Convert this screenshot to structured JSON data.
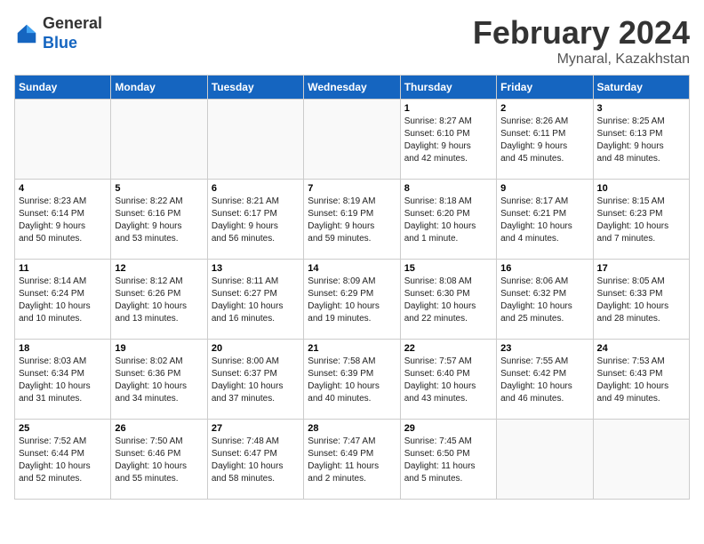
{
  "header": {
    "logo_general": "General",
    "logo_blue": "Blue",
    "title": "February 2024",
    "subtitle": "Mynaral, Kazakhstan"
  },
  "weekdays": [
    "Sunday",
    "Monday",
    "Tuesday",
    "Wednesday",
    "Thursday",
    "Friday",
    "Saturday"
  ],
  "weeks": [
    [
      {
        "day": "",
        "info": ""
      },
      {
        "day": "",
        "info": ""
      },
      {
        "day": "",
        "info": ""
      },
      {
        "day": "",
        "info": ""
      },
      {
        "day": "1",
        "info": "Sunrise: 8:27 AM\nSunset: 6:10 PM\nDaylight: 9 hours\nand 42 minutes."
      },
      {
        "day": "2",
        "info": "Sunrise: 8:26 AM\nSunset: 6:11 PM\nDaylight: 9 hours\nand 45 minutes."
      },
      {
        "day": "3",
        "info": "Sunrise: 8:25 AM\nSunset: 6:13 PM\nDaylight: 9 hours\nand 48 minutes."
      }
    ],
    [
      {
        "day": "4",
        "info": "Sunrise: 8:23 AM\nSunset: 6:14 PM\nDaylight: 9 hours\nand 50 minutes."
      },
      {
        "day": "5",
        "info": "Sunrise: 8:22 AM\nSunset: 6:16 PM\nDaylight: 9 hours\nand 53 minutes."
      },
      {
        "day": "6",
        "info": "Sunrise: 8:21 AM\nSunset: 6:17 PM\nDaylight: 9 hours\nand 56 minutes."
      },
      {
        "day": "7",
        "info": "Sunrise: 8:19 AM\nSunset: 6:19 PM\nDaylight: 9 hours\nand 59 minutes."
      },
      {
        "day": "8",
        "info": "Sunrise: 8:18 AM\nSunset: 6:20 PM\nDaylight: 10 hours\nand 1 minute."
      },
      {
        "day": "9",
        "info": "Sunrise: 8:17 AM\nSunset: 6:21 PM\nDaylight: 10 hours\nand 4 minutes."
      },
      {
        "day": "10",
        "info": "Sunrise: 8:15 AM\nSunset: 6:23 PM\nDaylight: 10 hours\nand 7 minutes."
      }
    ],
    [
      {
        "day": "11",
        "info": "Sunrise: 8:14 AM\nSunset: 6:24 PM\nDaylight: 10 hours\nand 10 minutes."
      },
      {
        "day": "12",
        "info": "Sunrise: 8:12 AM\nSunset: 6:26 PM\nDaylight: 10 hours\nand 13 minutes."
      },
      {
        "day": "13",
        "info": "Sunrise: 8:11 AM\nSunset: 6:27 PM\nDaylight: 10 hours\nand 16 minutes."
      },
      {
        "day": "14",
        "info": "Sunrise: 8:09 AM\nSunset: 6:29 PM\nDaylight: 10 hours\nand 19 minutes."
      },
      {
        "day": "15",
        "info": "Sunrise: 8:08 AM\nSunset: 6:30 PM\nDaylight: 10 hours\nand 22 minutes."
      },
      {
        "day": "16",
        "info": "Sunrise: 8:06 AM\nSunset: 6:32 PM\nDaylight: 10 hours\nand 25 minutes."
      },
      {
        "day": "17",
        "info": "Sunrise: 8:05 AM\nSunset: 6:33 PM\nDaylight: 10 hours\nand 28 minutes."
      }
    ],
    [
      {
        "day": "18",
        "info": "Sunrise: 8:03 AM\nSunset: 6:34 PM\nDaylight: 10 hours\nand 31 minutes."
      },
      {
        "day": "19",
        "info": "Sunrise: 8:02 AM\nSunset: 6:36 PM\nDaylight: 10 hours\nand 34 minutes."
      },
      {
        "day": "20",
        "info": "Sunrise: 8:00 AM\nSunset: 6:37 PM\nDaylight: 10 hours\nand 37 minutes."
      },
      {
        "day": "21",
        "info": "Sunrise: 7:58 AM\nSunset: 6:39 PM\nDaylight: 10 hours\nand 40 minutes."
      },
      {
        "day": "22",
        "info": "Sunrise: 7:57 AM\nSunset: 6:40 PM\nDaylight: 10 hours\nand 43 minutes."
      },
      {
        "day": "23",
        "info": "Sunrise: 7:55 AM\nSunset: 6:42 PM\nDaylight: 10 hours\nand 46 minutes."
      },
      {
        "day": "24",
        "info": "Sunrise: 7:53 AM\nSunset: 6:43 PM\nDaylight: 10 hours\nand 49 minutes."
      }
    ],
    [
      {
        "day": "25",
        "info": "Sunrise: 7:52 AM\nSunset: 6:44 PM\nDaylight: 10 hours\nand 52 minutes."
      },
      {
        "day": "26",
        "info": "Sunrise: 7:50 AM\nSunset: 6:46 PM\nDaylight: 10 hours\nand 55 minutes."
      },
      {
        "day": "27",
        "info": "Sunrise: 7:48 AM\nSunset: 6:47 PM\nDaylight: 10 hours\nand 58 minutes."
      },
      {
        "day": "28",
        "info": "Sunrise: 7:47 AM\nSunset: 6:49 PM\nDaylight: 11 hours\nand 2 minutes."
      },
      {
        "day": "29",
        "info": "Sunrise: 7:45 AM\nSunset: 6:50 PM\nDaylight: 11 hours\nand 5 minutes."
      },
      {
        "day": "",
        "info": ""
      },
      {
        "day": "",
        "info": ""
      }
    ]
  ]
}
